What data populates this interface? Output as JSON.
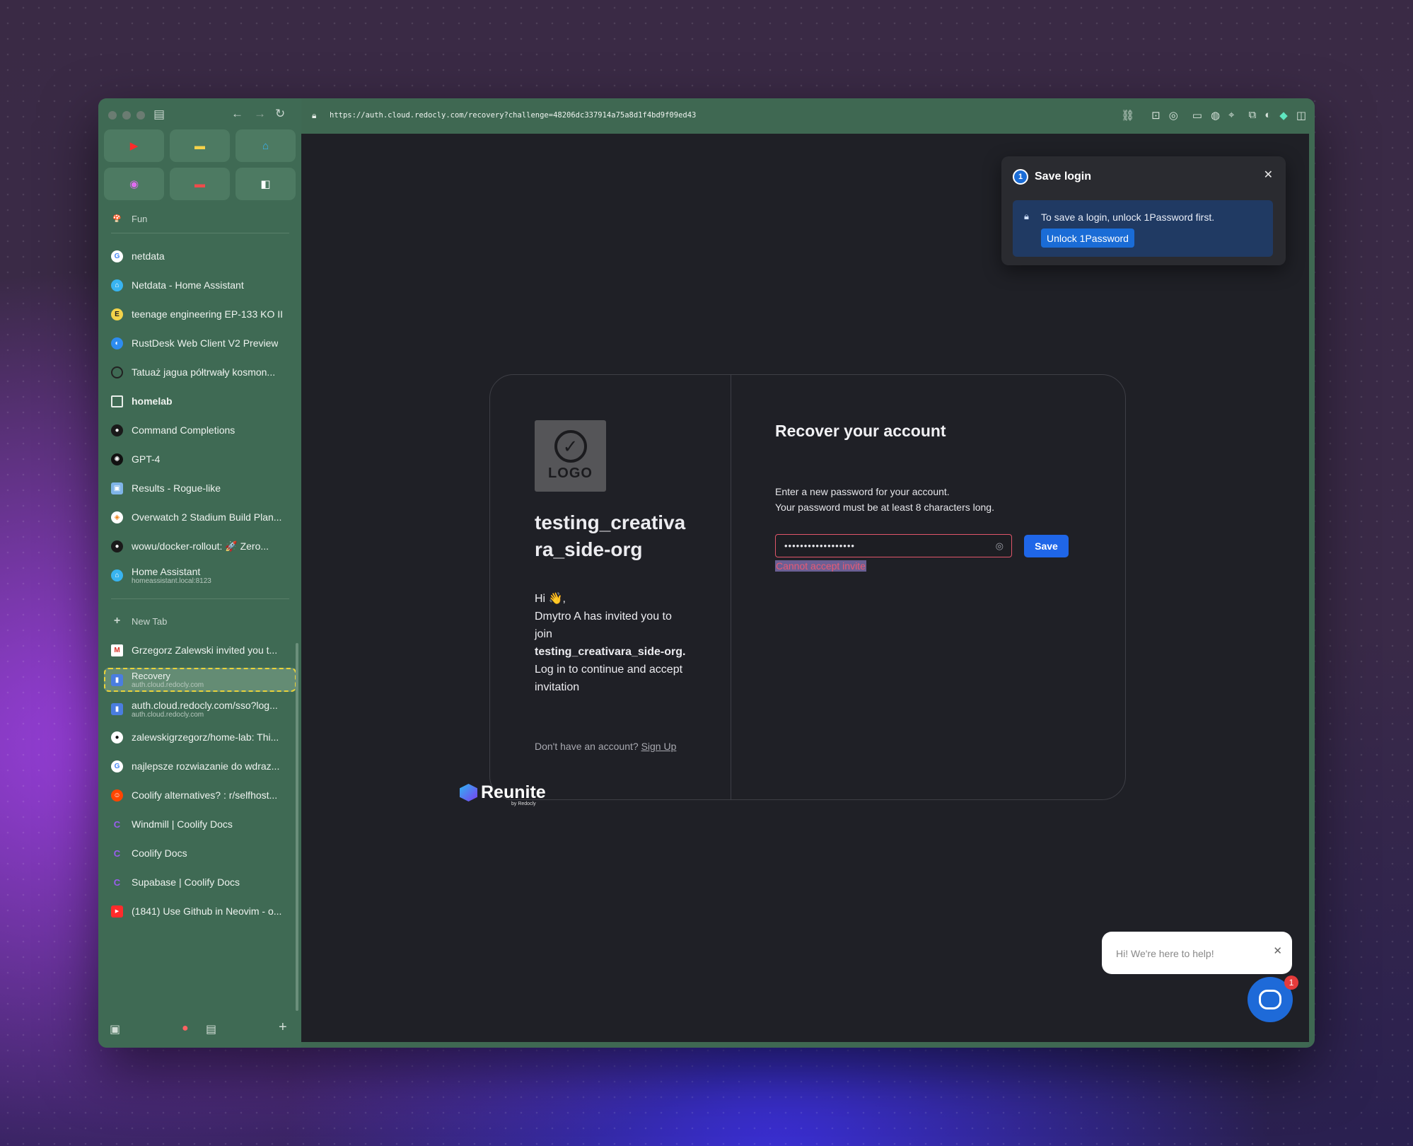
{
  "browser": {
    "url": "https://auth.cloud.redocly.com/recovery?challenge=48206dc337914a75a8d1f4bd9f09ed43"
  },
  "sidebar": {
    "folder_fun": "Fun",
    "items": [
      {
        "label": "netdata"
      },
      {
        "label": "Netdata - Home Assistant"
      },
      {
        "label": "teenage engineering EP-133 KO II"
      },
      {
        "label": "RustDesk Web Client V2 Preview"
      },
      {
        "label": "Tatuaż jagua półtrwały kosmon..."
      },
      {
        "label": "homelab"
      },
      {
        "label": "Command Completions"
      },
      {
        "label": "GPT-4"
      },
      {
        "label": "Results - Rogue-like"
      },
      {
        "label": "Overwatch 2 Stadium Build Plan..."
      },
      {
        "label": "wowu/docker-rollout: 🚀 Zero..."
      },
      {
        "label": "Home Assistant",
        "sub": "homeassistant.local:8123"
      }
    ],
    "new_tab": "New Tab",
    "tabs": [
      {
        "label": "Grzegorz Zalewski invited you t..."
      },
      {
        "label": "Recovery",
        "sub": "auth.cloud.redocly.com"
      },
      {
        "label": "auth.cloud.redocly.com/sso?log...",
        "sub": "auth.cloud.redocly.com"
      },
      {
        "label": "zalewskigrzegorz/home-lab: Thi..."
      },
      {
        "label": "najlepsze rozwiazanie do wdraz..."
      },
      {
        "label": "Coolify alternatives? : r/selfhost..."
      },
      {
        "label": "Windmill | Coolify Docs"
      },
      {
        "label": "Coolify Docs"
      },
      {
        "label": "Supabase | Coolify Docs"
      },
      {
        "label": "(1841) Use Github in Neovim - o..."
      }
    ]
  },
  "onepassword": {
    "title": "Save login",
    "message": "To save a login, unlock 1Password first.",
    "button": "Unlock 1Password"
  },
  "card": {
    "logo_text": "LOGO",
    "org_name": "testing_creativara_side-org",
    "greeting": "Hi 👋,",
    "invite_line1": "Dmytro A has invited you to join",
    "invite_org": "testing_creativara_side-org.",
    "invite_line2": "Log in to continue and accept invitation",
    "no_account": "Don't have an account?",
    "signup": "Sign Up",
    "title": "Recover your account",
    "desc_line1": "Enter a new password for your account.",
    "desc_line2": "Your password must be at least 8 characters long.",
    "password_mask": "••••••••••••••••••",
    "save_label": "Save",
    "error": "Cannot accept invite"
  },
  "footer": {
    "brand": "Reunite",
    "by": "by Redocly"
  },
  "chat": {
    "message": "Hi! We're here to help!",
    "badge": "1"
  },
  "colors": {
    "sidebar": "#3f6a54",
    "content_bg": "#1f2026",
    "accent": "#1f66e8",
    "error": "#e85a74"
  }
}
